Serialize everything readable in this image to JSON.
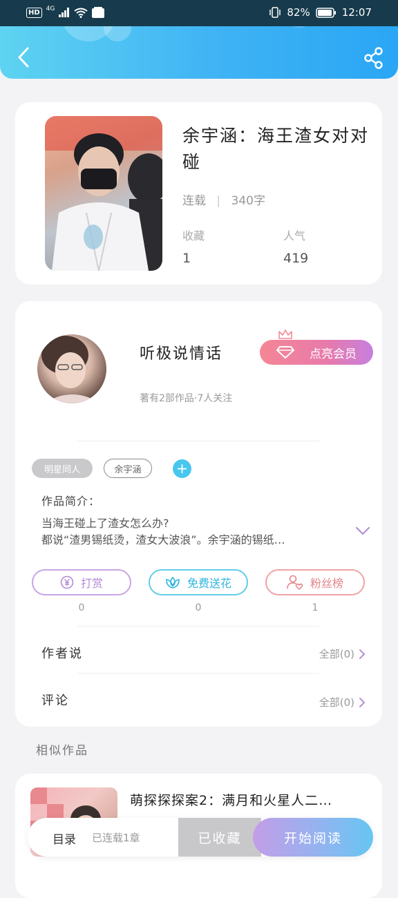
{
  "status_bar": {
    "network": "HD",
    "signal_type": "4G",
    "battery": "82%",
    "time": "12:07"
  },
  "header": {
    "back_icon": "back-arrow-icon",
    "share_icon": "share-icon"
  },
  "book": {
    "title": "余宇涵：海王渣女对对碰",
    "status": "连载",
    "word_count": "340字",
    "stats": [
      {
        "label": "收藏",
        "value": "1"
      },
      {
        "label": "人气",
        "value": "419"
      }
    ]
  },
  "author": {
    "name": "听极说情话",
    "summary": "著有2部作品·7人关注",
    "vip_button": "点亮会员"
  },
  "tags": [
    "明星同人",
    "余宇涵"
  ],
  "add_tag_symbol": "+",
  "intro": {
    "label": "作品简介：",
    "line1": "当海王碰上了渣女怎么办?",
    "line2": "都说“渣男锡纸烫，渣女大波浪”。余宇涵的锡纸…"
  },
  "actions": [
    {
      "label": "打赏",
      "count": "0"
    },
    {
      "label": "免费送花",
      "count": "0"
    },
    {
      "label": "粉丝榜",
      "count": "1"
    }
  ],
  "rows": [
    {
      "label": "作者说",
      "right": "全部(0)"
    },
    {
      "label": "评论",
      "right": "全部(0)"
    }
  ],
  "similar": {
    "section_title": "相似作品",
    "items": [
      {
        "title": "萌探探探案2：满月和火星人二…"
      }
    ]
  },
  "bottom_bar": {
    "toc": "目录",
    "serial": "已连载1章",
    "favorited": "已收藏",
    "start_reading": "开始阅读"
  },
  "colors": {
    "header_start": "#5fd3f1",
    "header_end": "#2aa6f5",
    "vip_start": "#f58695",
    "vip_end": "#c77fdf",
    "reward": "#b58ad6",
    "flower": "#2fb5df",
    "fans": "#e5838a"
  }
}
